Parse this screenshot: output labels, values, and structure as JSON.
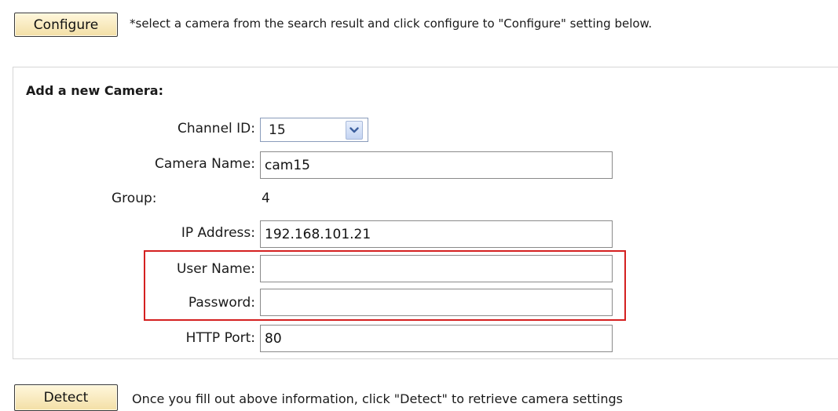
{
  "toolbar": {
    "configure_label": "Configure",
    "configure_note": "*select a camera from the search result and click configure to \"Configure\" setting below."
  },
  "form": {
    "title": "Add a new Camera:",
    "channel_id": {
      "label": "Channel ID:",
      "value": "15"
    },
    "camera_name": {
      "label": "Camera Name:",
      "value": "cam15"
    },
    "group": {
      "label": "Group:",
      "value": "4"
    },
    "ip_address": {
      "label": "IP Address:",
      "value": "192.168.101.21"
    },
    "user_name": {
      "label": "User Name:",
      "value": ""
    },
    "password": {
      "label": "Password:",
      "value": ""
    },
    "http_port": {
      "label": "HTTP Port:",
      "value": "80"
    }
  },
  "footer": {
    "detect_label": "Detect",
    "detect_note": "Once you fill out above information, click \"Detect\" to retrieve camera settings"
  },
  "colors": {
    "button_bg": "#f3dfa6",
    "highlight_border": "#d42020",
    "select_arrow_bg": "#c4d4f2"
  },
  "icons": {
    "select_arrow": "chevron-down-icon"
  }
}
